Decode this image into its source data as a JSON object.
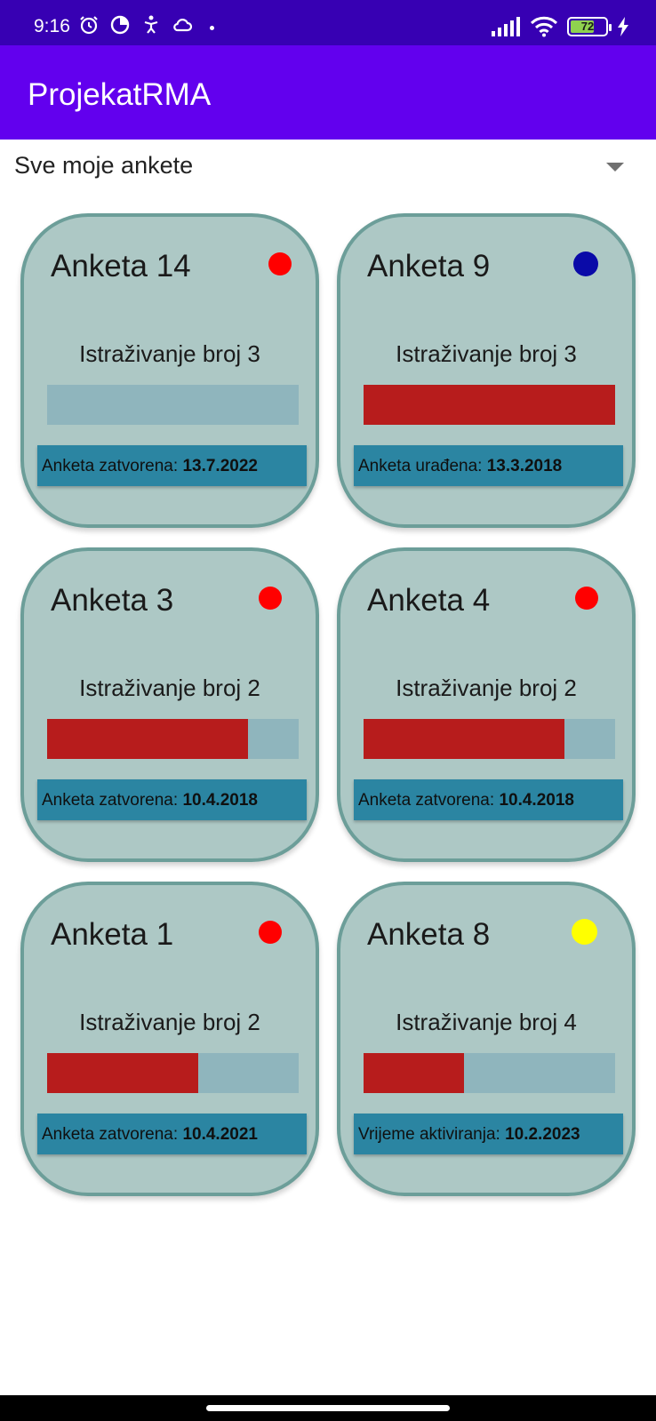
{
  "status_bar": {
    "time": "9:16",
    "icons": [
      "alarm-icon",
      "data-saver-icon",
      "accessibility-icon",
      "cloud-icon",
      "signal-icon",
      "wifi-icon",
      "battery-icon",
      "charging-icon"
    ],
    "battery_level": "72",
    "battery_fraction": 0.72
  },
  "app_bar": {
    "title": "ProjekatRMA"
  },
  "filter": {
    "selected": "Sve moje ankete",
    "icon": "dropdown-arrow-icon"
  },
  "colors": {
    "app_bar": "#6200ee",
    "status_bar": "#3700b3",
    "card_bg": "#adc8c5",
    "progress_fill": "#b71c1c",
    "status_strip": "#2b85a2"
  },
  "cards": [
    {
      "title": "Anketa 14",
      "indicator_color": "#ff0000",
      "research": "Istraživanje broj 3",
      "progress": 0.0,
      "status_label": "Anketa zatvorena: ",
      "status_date": "13.7.2022"
    },
    {
      "title": "Anketa 9",
      "indicator_color": "#0a0aa8",
      "research": "Istraživanje broj 3",
      "progress": 1.0,
      "status_label": "Anketa urađena: ",
      "status_date": "13.3.2018"
    },
    {
      "title": "Anketa 3",
      "indicator_color": "#ff0000",
      "research": "Istraživanje broj 2",
      "progress": 0.8,
      "status_label": "Anketa zatvorena: ",
      "status_date": "10.4.2018"
    },
    {
      "title": "Anketa 4",
      "indicator_color": "#ff0000",
      "research": "Istraživanje broj 2",
      "progress": 0.8,
      "status_label": "Anketa zatvorena: ",
      "status_date": "10.4.2018"
    },
    {
      "title": "Anketa 1",
      "indicator_color": "#ff0000",
      "research": "Istraživanje broj 2",
      "progress": 0.6,
      "status_label": "Anketa zatvorena: ",
      "status_date": "10.4.2021"
    },
    {
      "title": "Anketa 8",
      "indicator_color": "#ffff00",
      "research": "Istraživanje broj 4",
      "progress": 0.4,
      "status_label": "Vrijeme aktiviranja: ",
      "status_date": "10.2.2023"
    }
  ]
}
